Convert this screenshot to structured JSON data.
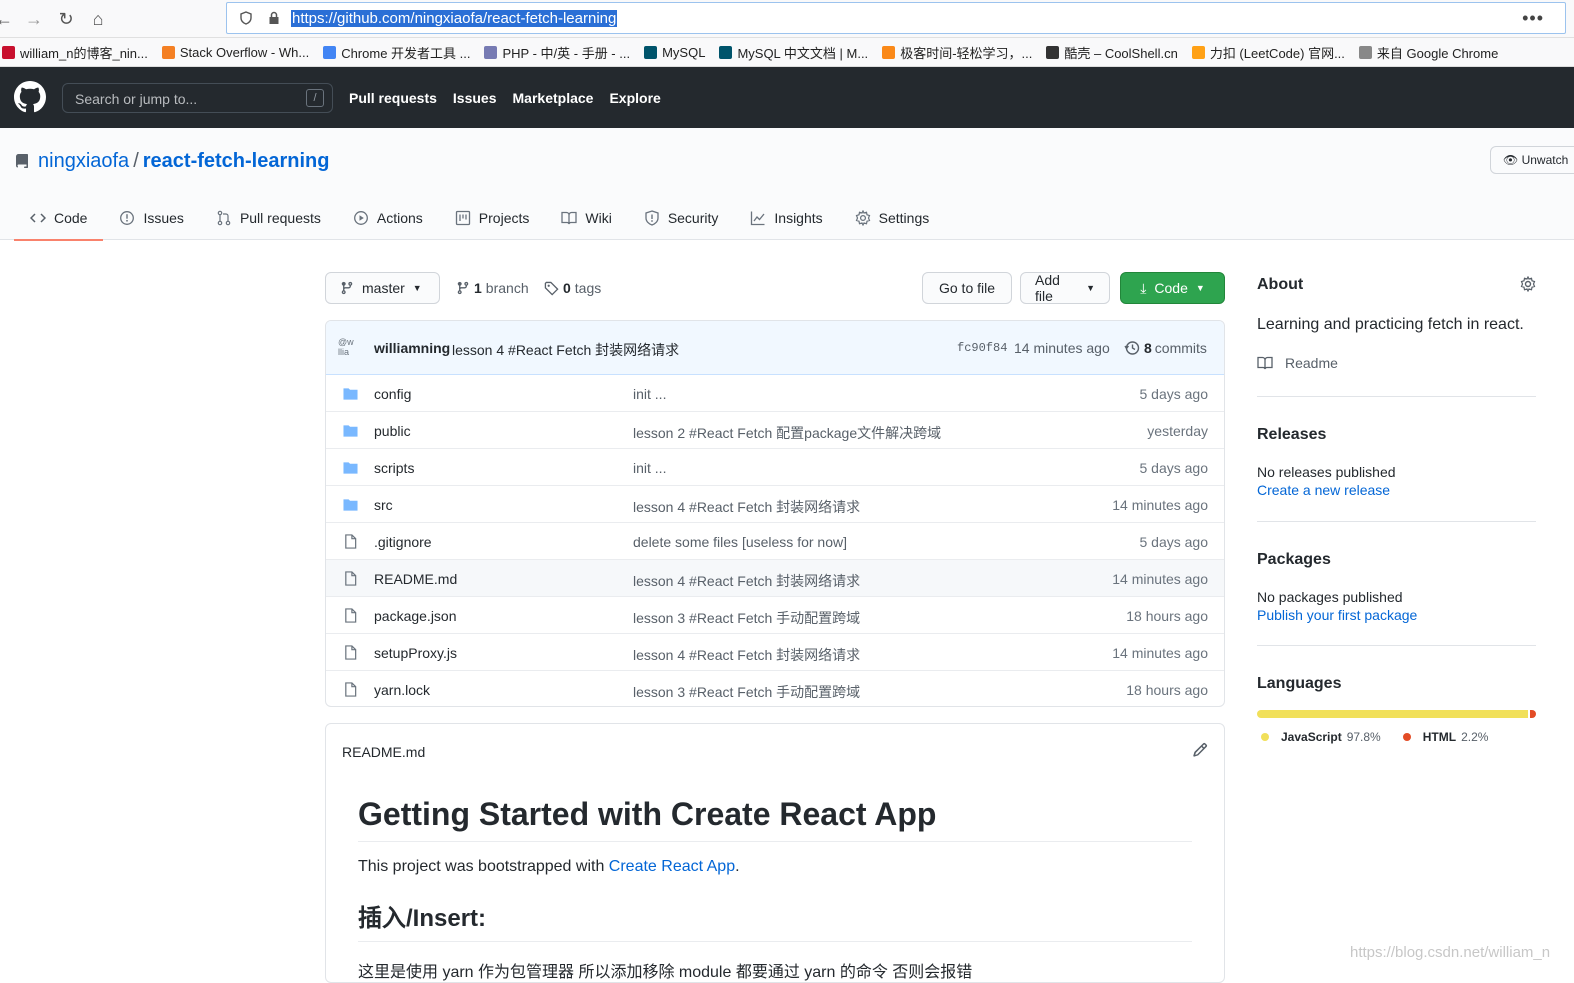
{
  "browser": {
    "url": "https://github.com/ningxiaofa/react-fetch-learning",
    "menu": "•••",
    "bookmarks": [
      {
        "label": "william_n的博客_nin...",
        "color": "#c8102e"
      },
      {
        "label": "Stack Overflow - Wh...",
        "color": "#f48024"
      },
      {
        "label": "Chrome 开发者工具 ...",
        "color": "#4285f4"
      },
      {
        "label": "PHP - 中/英 - 手册 - ...",
        "color": "#777bb3"
      },
      {
        "label": "MySQL",
        "color": "#00546b"
      },
      {
        "label": "MySQL 中文文档 | M...",
        "color": "#00546b"
      },
      {
        "label": "极客时间-轻松学习，...",
        "color": "#fa8919"
      },
      {
        "label": "酷壳 – CoolShell.cn",
        "color": "#333333"
      },
      {
        "label": "力扣 (LeetCode) 官网...",
        "color": "#ffa116"
      },
      {
        "label": "来自 Google Chrome",
        "color": "#888888"
      }
    ]
  },
  "gh_header": {
    "search_placeholder": "Search or jump to...",
    "slash_key": "/",
    "nav": [
      "Pull requests",
      "Issues",
      "Marketplace",
      "Explore"
    ]
  },
  "repo": {
    "owner": "ningxiaofa",
    "separator": "/",
    "name": "react-fetch-learning",
    "unwatch": "Unwatch"
  },
  "tabs": [
    {
      "label": "Code",
      "icon": "code-icon"
    },
    {
      "label": "Issues",
      "icon": "issue-icon"
    },
    {
      "label": "Pull requests",
      "icon": "pull-request-icon"
    },
    {
      "label": "Actions",
      "icon": "play-icon"
    },
    {
      "label": "Projects",
      "icon": "project-icon"
    },
    {
      "label": "Wiki",
      "icon": "book-icon"
    },
    {
      "label": "Security",
      "icon": "shield-icon"
    },
    {
      "label": "Insights",
      "icon": "graph-icon"
    },
    {
      "label": "Settings",
      "icon": "gear-icon"
    }
  ],
  "toolbar": {
    "branch": "master",
    "branch_count": "1",
    "branch_word": "branch",
    "tag_count": "0",
    "tag_word": "tags",
    "go_to_file": "Go to file",
    "add_file": "Add file",
    "code": "Code"
  },
  "commit": {
    "avatar_text": "@w\nllia",
    "author": "williamning",
    "message": "lesson 4 #React Fetch 封装网络请求",
    "sha": "fc90f84",
    "time": "14 minutes ago",
    "count": "8",
    "count_word": "commits"
  },
  "files": [
    {
      "name": "config",
      "type": "dir",
      "message": "init ...",
      "age": "5 days ago"
    },
    {
      "name": "public",
      "type": "dir",
      "message": "lesson 2 #React Fetch 配置package文件解决跨域",
      "age": "yesterday"
    },
    {
      "name": "scripts",
      "type": "dir",
      "message": "init ...",
      "age": "5 days ago"
    },
    {
      "name": "src",
      "type": "dir",
      "message": "lesson 4 #React Fetch 封装网络请求",
      "age": "14 minutes ago"
    },
    {
      "name": ".gitignore",
      "type": "file",
      "message": "delete some files [useless for now]",
      "age": "5 days ago"
    },
    {
      "name": "README.md",
      "type": "file",
      "message": "lesson 4 #React Fetch 封装网络请求",
      "age": "14 minutes ago"
    },
    {
      "name": "package.json",
      "type": "file",
      "message": "lesson 3 #React Fetch 手动配置跨域",
      "age": "18 hours ago"
    },
    {
      "name": "setupProxy.js",
      "type": "file",
      "message": "lesson 4 #React Fetch 封装网络请求",
      "age": "14 minutes ago"
    },
    {
      "name": "yarn.lock",
      "type": "file",
      "message": "lesson 3 #React Fetch 手动配置跨域",
      "age": "18 hours ago"
    }
  ],
  "readme": {
    "filename": "README.md",
    "h1": "Getting Started with Create React App",
    "p_prefix": "This project was bootstrapped with ",
    "p_link": "Create React App",
    "p_suffix": ".",
    "h2": "插入/Insert:",
    "cut_text": "这里是使用 yarn 作为包管理器 所以添加移除 module 都要通过 yarn 的命令 否则会报错"
  },
  "sidebar": {
    "about_title": "About",
    "about_desc": "Learning and practicing fetch in react.",
    "readme_link": "Readme",
    "releases_title": "Releases",
    "releases_none": "No releases published",
    "releases_create": "Create a new release",
    "packages_title": "Packages",
    "packages_none": "No packages published",
    "packages_publish": "Publish your first package",
    "languages_title": "Languages",
    "languages": [
      {
        "name": "JavaScript",
        "percent": "97.8%",
        "value": 97.8,
        "color": "#f1e05a"
      },
      {
        "name": "HTML",
        "percent": "2.2%",
        "value": 2.2,
        "color": "#e34c26"
      }
    ]
  },
  "watermark": "https://blog.csdn.net/william_n"
}
